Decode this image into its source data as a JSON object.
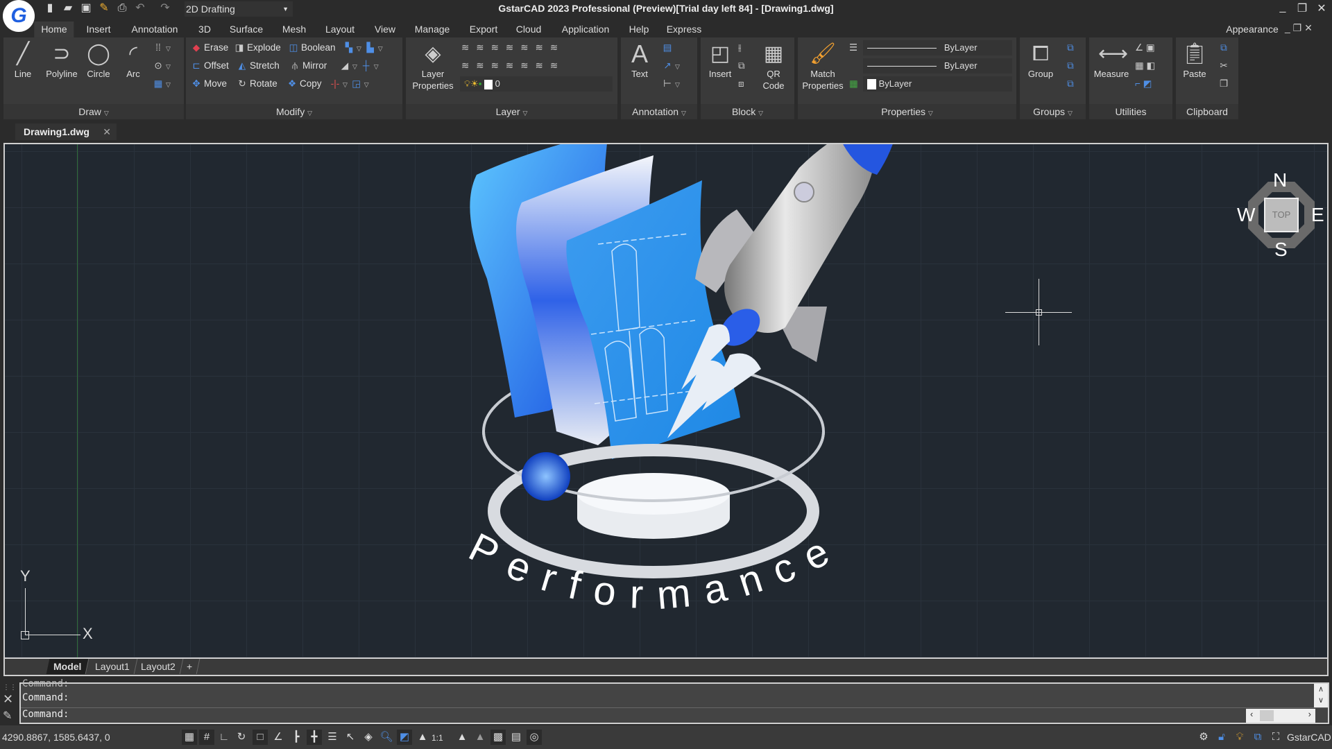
{
  "app": {
    "title": "GstarCAD 2023 Professional (Preview)[Trial day left 84] - [Drawing1.dwg]",
    "logo": "G",
    "workspace": "2D Drafting"
  },
  "colors": {
    "accent": "#2f6fe0",
    "canvas": "#212830",
    "panel": "#3a3a3a"
  },
  "quick_access": [
    "new-icon",
    "open-icon",
    "save-icon",
    "save-as-icon",
    "print-icon",
    "undo-icon",
    "redo-icon"
  ],
  "menu": [
    "Home",
    "Insert",
    "Annotation",
    "3D",
    "Surface",
    "Mesh",
    "Layout",
    "View",
    "Manage",
    "Export",
    "Cloud",
    "Application",
    "Help",
    "Express"
  ],
  "appearance": "Appearance",
  "ribbon": {
    "draw": {
      "label": "Draw",
      "line": "Line",
      "polyline": "Polyline",
      "circle": "Circle",
      "arc": "Arc"
    },
    "modify": {
      "label": "Modify",
      "erase": "Erase",
      "explode": "Explode",
      "boolean": "Boolean",
      "offset": "Offset",
      "stretch": "Stretch",
      "mirror": "Mirror",
      "move": "Move",
      "rotate": "Rotate",
      "copy": "Copy"
    },
    "layer": {
      "label": "Layer",
      "properties": "Layer Properties",
      "current": "0"
    },
    "annotation": {
      "label": "Annotation",
      "text": "Text"
    },
    "block": {
      "label": "Block",
      "insert": "Insert",
      "qr": "QR Code"
    },
    "properties": {
      "label": "Properties",
      "match": "Match Properties",
      "linetype": "ByLayer",
      "lineweight": "ByLayer",
      "color": "ByLayer"
    },
    "groups": {
      "label": "Groups",
      "group": "Group"
    },
    "utilities": {
      "label": "Utilities",
      "measure": "Measure"
    },
    "clipboard": {
      "label": "Clipboard",
      "paste": "Paste"
    }
  },
  "document_tab": "Drawing1.dwg",
  "viewcube": {
    "top": "TOP",
    "n": "N",
    "s": "S",
    "e": "E",
    "w": "W"
  },
  "ucs": {
    "x": "X",
    "y": "Y"
  },
  "artwork_text": "Performance",
  "layout_tabs": [
    "Model",
    "Layout1",
    "Layout2",
    "+"
  ],
  "command": {
    "lines": [
      "Command:",
      "Command:",
      "Command:"
    ]
  },
  "status": {
    "coords": "4290.8867, 1585.6437, 0",
    "scale": "1:1",
    "brand": "GstarCAD"
  }
}
